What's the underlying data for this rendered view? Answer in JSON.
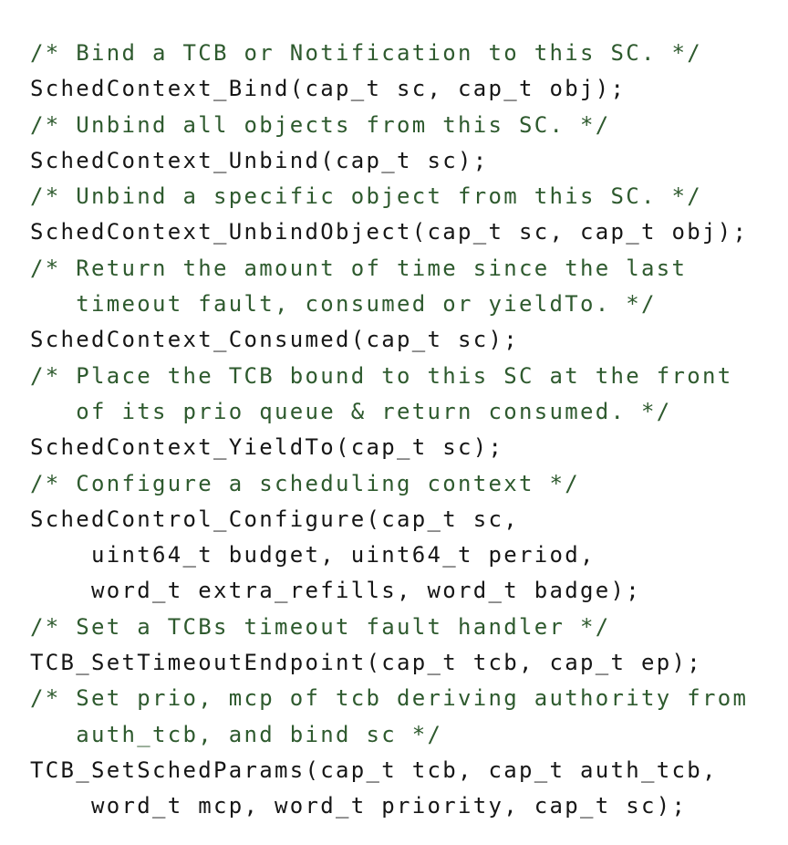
{
  "code": {
    "colors": {
      "code_text": "#161616",
      "comment_text": "#2e5a2e",
      "background": "#ffffff"
    },
    "lines": [
      {
        "kind": "comment",
        "text": "/* Bind a TCB or Notification to this SC. */"
      },
      {
        "kind": "code",
        "text": "SchedContext_Bind(cap_t sc, cap_t obj);"
      },
      {
        "kind": "comment",
        "text": "/* Unbind all objects from this SC. */"
      },
      {
        "kind": "code",
        "text": "SchedContext_Unbind(cap_t sc);"
      },
      {
        "kind": "comment",
        "text": "/* Unbind a specific object from this SC. */"
      },
      {
        "kind": "code",
        "text": "SchedContext_UnbindObject(cap_t sc, cap_t obj);"
      },
      {
        "kind": "comment",
        "text": "/* Return the amount of time since the last"
      },
      {
        "kind": "comment",
        "text": "   timeout fault, consumed or yieldTo. */"
      },
      {
        "kind": "code",
        "text": "SchedContext_Consumed(cap_t sc);"
      },
      {
        "kind": "comment",
        "text": "/* Place the TCB bound to this SC at the front"
      },
      {
        "kind": "comment",
        "text": "   of its prio queue & return consumed. */"
      },
      {
        "kind": "code",
        "text": "SchedContext_YieldTo(cap_t sc);"
      },
      {
        "kind": "comment",
        "text": "/* Configure a scheduling context */"
      },
      {
        "kind": "code",
        "text": "SchedControl_Configure(cap_t sc,"
      },
      {
        "kind": "code",
        "text": "    uint64_t budget, uint64_t period,"
      },
      {
        "kind": "code",
        "text": "    word_t extra_refills, word_t badge);"
      },
      {
        "kind": "comment",
        "text": "/* Set a TCBs timeout fault handler */"
      },
      {
        "kind": "code",
        "text": "TCB_SetTimeoutEndpoint(cap_t tcb, cap_t ep);"
      },
      {
        "kind": "comment",
        "text": "/* Set prio, mcp of tcb deriving authority from"
      },
      {
        "kind": "comment",
        "text": "   auth_tcb, and bind sc */"
      },
      {
        "kind": "code",
        "text": "TCB_SetSchedParams(cap_t tcb, cap_t auth_tcb,"
      },
      {
        "kind": "code",
        "text": "    word_t mcp, word_t priority, cap_t sc);"
      }
    ]
  }
}
